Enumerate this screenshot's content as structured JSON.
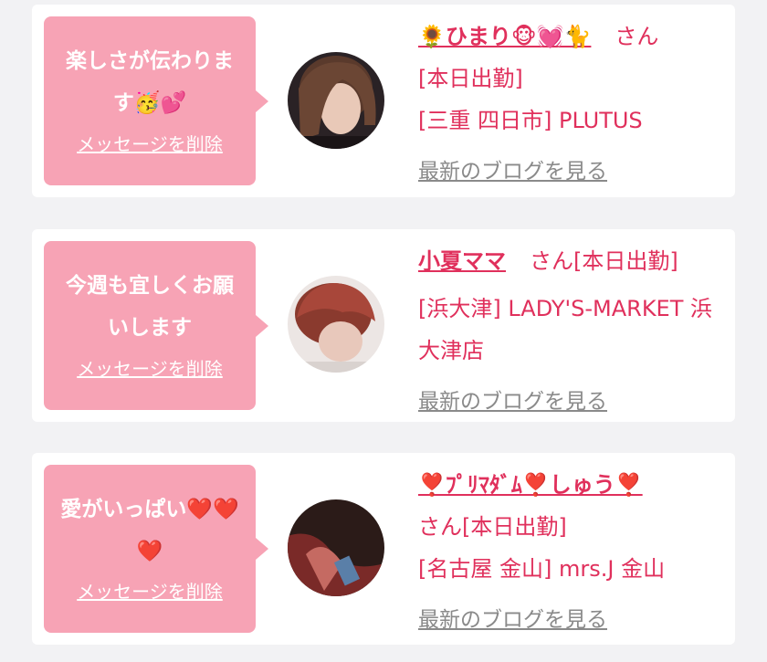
{
  "cards": [
    {
      "message": "楽しさが伝わります🥳💕",
      "delete_label": "メッセージを削除",
      "name": "🌻ひまり🐵💓🐈",
      "san": "さん",
      "status": "[本日出勤]",
      "location": "[三重 四日市] PLUTUS",
      "blog_label": "最新のブログを見る"
    },
    {
      "message": "今週も宜しくお願いします",
      "delete_label": "メッセージを削除",
      "name": "小夏ママ",
      "san_status": "さん[本日出勤]",
      "location": "[浜大津] LADY'S-MARKET 浜大津店",
      "blog_label": "最新のブログを見る"
    },
    {
      "message": "愛がいっぱい❤️❤️❤️",
      "delete_label": "メッセージを削除",
      "name": "❣️ﾌﾟﾘﾏﾀﾞﾑ❣️しゅう❣️",
      "san_status": "さん[本日出勤]",
      "location": "[名古屋 金山] mrs.J 金山",
      "blog_label": "最新のブログを見る"
    }
  ],
  "colors": {
    "accent": "#e0305c",
    "bubble": "#f7a3b5",
    "link_gray": "#8a8a8a",
    "background": "#f2f2f4"
  }
}
